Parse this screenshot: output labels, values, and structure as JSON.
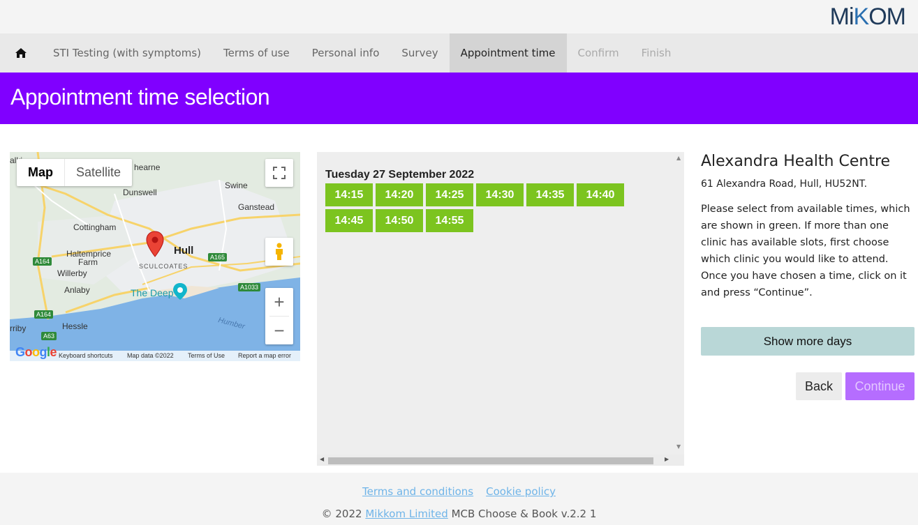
{
  "brand": {
    "logo_text_a": "Mi",
    "logo_text_b": "K",
    "logo_text_c": "OM"
  },
  "nav": {
    "items": [
      {
        "label": "STI Testing (with symptoms)"
      },
      {
        "label": "Terms of use"
      },
      {
        "label": "Personal info"
      },
      {
        "label": "Survey"
      },
      {
        "label": "Appointment time"
      },
      {
        "label": "Confirm"
      },
      {
        "label": "Finish"
      }
    ],
    "active": "Appointment time"
  },
  "page": {
    "title": "Appointment time selection"
  },
  "map": {
    "toggle": {
      "map": "Map",
      "satellite": "Satellite"
    },
    "places": {
      "hearne": "hearne",
      "dunswell": "Dunswell",
      "swine": "Swine",
      "ganstead": "Ganstead",
      "cottingham": "Cottingham",
      "haltemprice": "Haltemprice",
      "farm": "Farm",
      "hull": "Hull",
      "sculcoates": "SCULCOATES",
      "willerby": "Willerby",
      "anlaby": "Anlaby",
      "the_deep": "The Deep",
      "hessle": "Hessle",
      "humber": "Humber",
      "irby": "rriby",
      "alk": "alki"
    },
    "roads": {
      "a164a": "A164",
      "a165": "A165",
      "a1033": "A1033",
      "a164b": "A164",
      "a63": "A63"
    },
    "attribution": {
      "google": "Google",
      "keyboard": "Keyboard shortcuts",
      "map_data": "Map data ©2022",
      "terms": "Terms of Use",
      "report": "Report a map error"
    },
    "zoom_in": "+",
    "zoom_out": "−"
  },
  "slots": {
    "date": "Tuesday 27 September 2022",
    "times": [
      "14:15",
      "14:20",
      "14:25",
      "14:30",
      "14:35",
      "14:40",
      "14:45",
      "14:50",
      "14:55"
    ]
  },
  "clinic": {
    "name": "Alexandra Health Centre",
    "address": "61 Alexandra Road, Hull, HU52NT.",
    "help": "Please select from available times, which are shown in green. If more than one clinic has available slots, first choose which clinic you would like to attend. Once you have chosen a time, click on it and press “Continue”."
  },
  "buttons": {
    "more_days": "Show more days",
    "back": "Back",
    "continue": "Continue"
  },
  "footer": {
    "terms": "Terms and conditions",
    "cookie": "Cookie policy",
    "copyright_prefix": "© 2022",
    "company": "Mikkom Limited",
    "copyright_suffix": "MCB Choose & Book v.2.2 1"
  },
  "colors": {
    "accent": "#8000ff",
    "slot": "#7cc41f",
    "more_days_bg": "#b9d7d7",
    "continue_bg": "#b56dff",
    "link": "#6fb4e8"
  }
}
